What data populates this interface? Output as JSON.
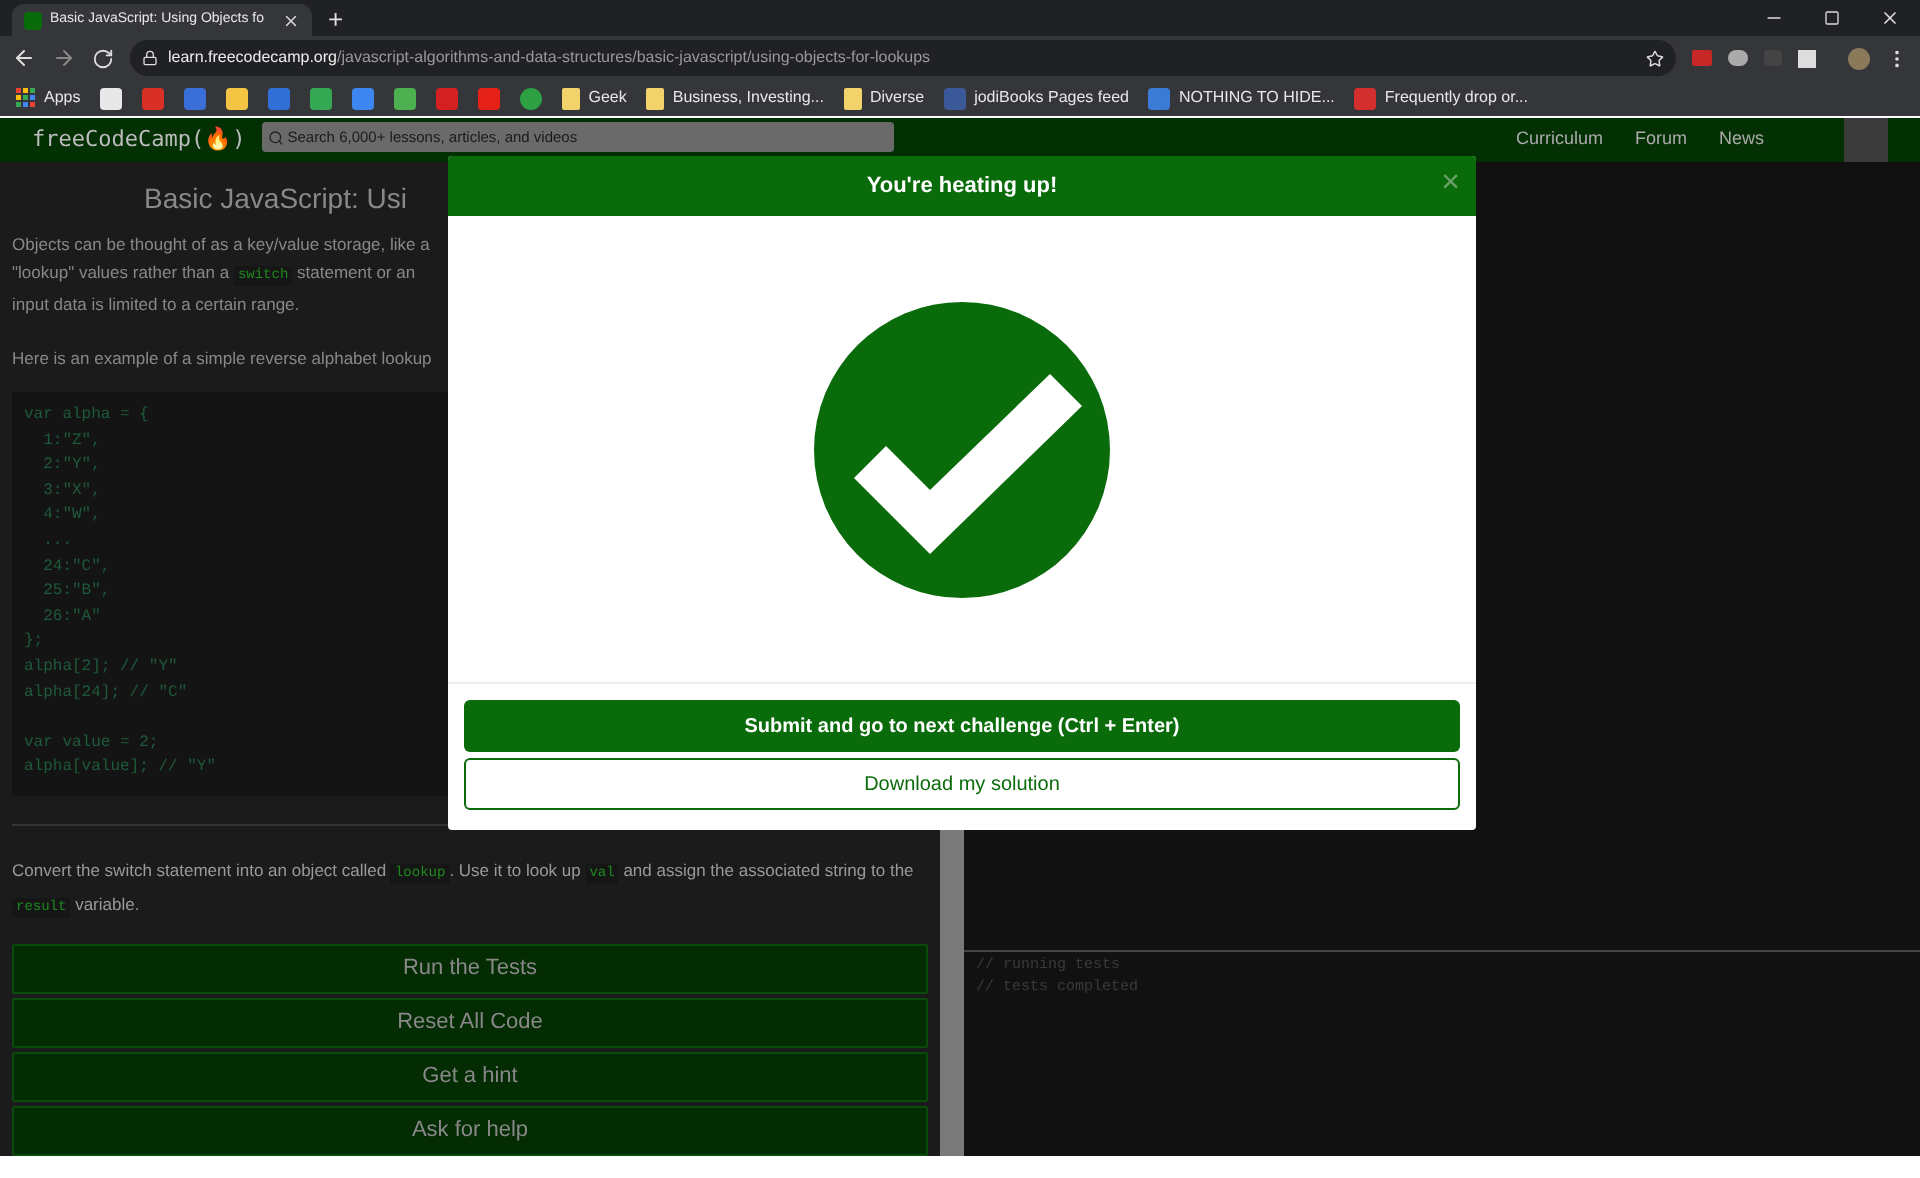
{
  "browser": {
    "tab_title": "Basic JavaScript: Using Objects fo",
    "new_tab": "+",
    "url_host": "learn.freecodecamp.org",
    "url_path": "/javascript-algorithms-and-data-structures/basic-javascript/using-objects-for-lookups",
    "bookmarks": [
      {
        "kind": "apps",
        "label": "Apps"
      },
      {
        "kind": "tile",
        "color": "#e8e8e8"
      },
      {
        "kind": "tile",
        "color": "#d93025"
      },
      {
        "kind": "tile",
        "color": "#3b6fd8"
      },
      {
        "kind": "tile",
        "color": "#f4c542"
      },
      {
        "kind": "tile",
        "color": "#2f6fd6"
      },
      {
        "kind": "tile",
        "color": "#34a853"
      },
      {
        "kind": "tile",
        "color": "#3d86f0"
      },
      {
        "kind": "tile",
        "color": "#4caf50"
      },
      {
        "kind": "tile",
        "color": "#d42020"
      },
      {
        "kind": "tile",
        "color": "#e62117"
      },
      {
        "kind": "dot",
        "color": "#2ea043"
      },
      {
        "kind": "folder",
        "color": "#f2d36b",
        "label": "Geek"
      },
      {
        "kind": "folder",
        "color": "#f2d36b",
        "label": "Business, Investing..."
      },
      {
        "kind": "folder",
        "color": "#f2d36b",
        "label": "Diverse"
      },
      {
        "kind": "tile",
        "color": "#3b5998",
        "label": "jodiBooks Pages feed"
      },
      {
        "kind": "tile",
        "color": "#3a7bd5",
        "label": "NOTHING TO HIDE..."
      },
      {
        "kind": "tile",
        "color": "#d32f2f",
        "label": "Frequently drop or..."
      }
    ]
  },
  "nav": {
    "logo": "freeCodeCamp(🔥)",
    "search_placeholder": "Search 6,000+ lessons, articles, and videos",
    "links": [
      "Curriculum",
      "Forum",
      "News"
    ]
  },
  "lesson": {
    "title": "Basic JavaScript: Usi",
    "intro": [
      [
        {
          "kind": "text",
          "text": "Objects can be thought of as a key/value storage, like a"
        }
      ],
      [
        {
          "kind": "text",
          "text": "\"lookup\" values rather than a "
        },
        {
          "kind": "code",
          "text": "switch"
        },
        {
          "kind": "text",
          "text": " statement or an"
        }
      ],
      [
        {
          "kind": "text",
          "text": "input data is limited to a certain range."
        }
      ]
    ],
    "example_intro": "Here is an example of a simple reverse alphabet lookup",
    "code": [
      [
        "var alpha = {",
        "  1:\"Z\",",
        "  2:\"Y\",",
        "  3:\"X\",",
        "  4:\"W\",",
        "  ...",
        "  24:\"C\",",
        "  25:\"B\",",
        "  26:\"A\"",
        "};",
        "alpha[2]; // \"Y\"",
        "alpha[24]; // \"C\""
      ],
      [
        "var value = 2;",
        "alpha[value]; // \"Y\""
      ]
    ],
    "instructions": [
      {
        "kind": "text",
        "text": "Convert the switch statement into an object called "
      },
      {
        "kind": "code",
        "text": "lookup"
      },
      {
        "kind": "text",
        "text": ". Use it to look up "
      },
      {
        "kind": "code",
        "text": "val"
      },
      {
        "kind": "text",
        "text": " and assign the associated string to the "
      },
      {
        "kind": "code",
        "text": "result"
      },
      {
        "kind": "text",
        "text": " variable."
      }
    ],
    "buttons": [
      "Run the Tests",
      "Reset All Code",
      "Get a hint",
      "Ask for help"
    ]
  },
  "console": [
    "// running tests",
    "// tests completed"
  ],
  "modal": {
    "title": "You're heating up!",
    "close": "×",
    "buttons": [
      {
        "label": "Submit and go to next challenge (Ctrl + Enter)",
        "kind": "primary"
      },
      {
        "label": "Download my solution",
        "kind": "outline"
      }
    ]
  }
}
